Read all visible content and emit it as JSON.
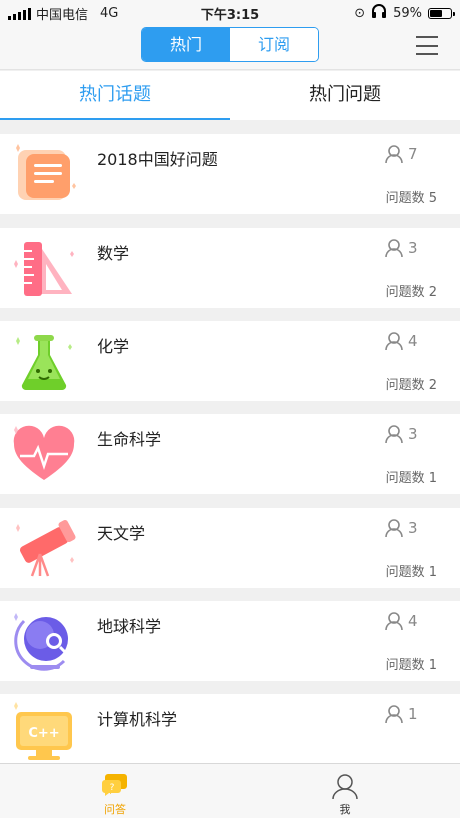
{
  "status_bar": {
    "carrier": "中国电信",
    "network": "4G",
    "time": "下午3:15",
    "battery": "59%",
    "battery_level": 0.59
  },
  "top_nav": {
    "segments": [
      "热门",
      "订阅"
    ],
    "active_segment": 0,
    "menu_icon": "hamburger-menu-icon"
  },
  "sub_tabs": {
    "items": [
      "热门话题",
      "热门问题"
    ],
    "active": 0
  },
  "topics": [
    {
      "title": "2018中国好问题",
      "members": "7",
      "questions": "问题数 5",
      "icon": "document-icon"
    },
    {
      "title": "数学",
      "members": "3",
      "questions": "问题数 2",
      "icon": "ruler-triangle-icon"
    },
    {
      "title": "化学",
      "members": "4",
      "questions": "问题数 2",
      "icon": "flask-icon"
    },
    {
      "title": "生命科学",
      "members": "3",
      "questions": "问题数 1",
      "icon": "heart-pulse-icon"
    },
    {
      "title": "天文学",
      "members": "3",
      "questions": "问题数 1",
      "icon": "telescope-icon"
    },
    {
      "title": "地球科学",
      "members": "4",
      "questions": "问题数 1",
      "icon": "globe-icon"
    },
    {
      "title": "计算机科学",
      "members": "1",
      "questions": "",
      "icon": "cpp-screen-icon",
      "icon_text": "C++"
    }
  ],
  "bottom_bar": {
    "items": [
      {
        "label": "问答",
        "icon": "qa-bubble-icon"
      },
      {
        "label": "我",
        "icon": "profile-icon"
      }
    ],
    "active": 0
  },
  "colors": {
    "accent": "#2e9df0",
    "active_tab_bottom": "#f0a300"
  }
}
